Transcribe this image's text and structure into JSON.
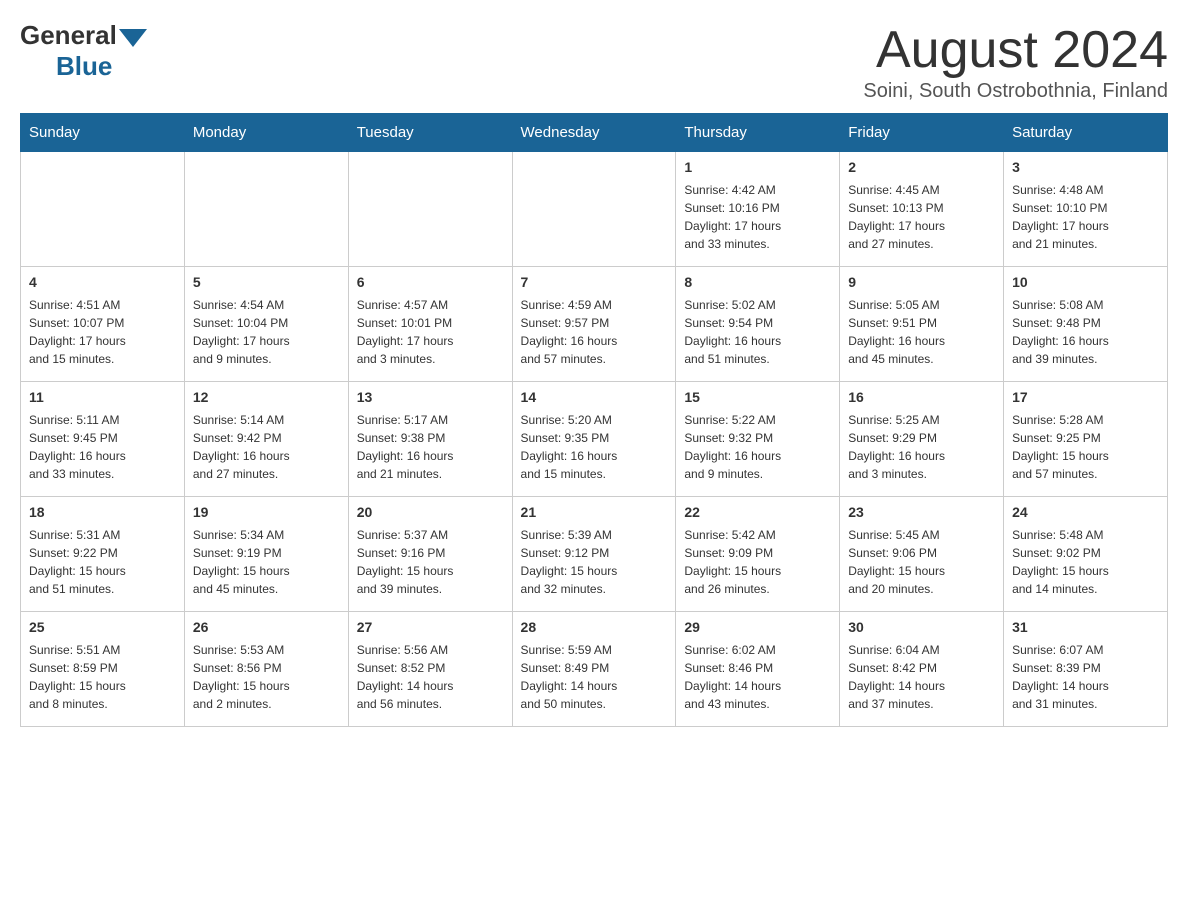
{
  "header": {
    "logo_general": "General",
    "logo_blue": "Blue",
    "month_title": "August 2024",
    "location": "Soini, South Ostrobothnia, Finland"
  },
  "weekdays": [
    "Sunday",
    "Monday",
    "Tuesday",
    "Wednesday",
    "Thursday",
    "Friday",
    "Saturday"
  ],
  "weeks": [
    [
      {
        "day": "",
        "info": ""
      },
      {
        "day": "",
        "info": ""
      },
      {
        "day": "",
        "info": ""
      },
      {
        "day": "",
        "info": ""
      },
      {
        "day": "1",
        "info": "Sunrise: 4:42 AM\nSunset: 10:16 PM\nDaylight: 17 hours\nand 33 minutes."
      },
      {
        "day": "2",
        "info": "Sunrise: 4:45 AM\nSunset: 10:13 PM\nDaylight: 17 hours\nand 27 minutes."
      },
      {
        "day": "3",
        "info": "Sunrise: 4:48 AM\nSunset: 10:10 PM\nDaylight: 17 hours\nand 21 minutes."
      }
    ],
    [
      {
        "day": "4",
        "info": "Sunrise: 4:51 AM\nSunset: 10:07 PM\nDaylight: 17 hours\nand 15 minutes."
      },
      {
        "day": "5",
        "info": "Sunrise: 4:54 AM\nSunset: 10:04 PM\nDaylight: 17 hours\nand 9 minutes."
      },
      {
        "day": "6",
        "info": "Sunrise: 4:57 AM\nSunset: 10:01 PM\nDaylight: 17 hours\nand 3 minutes."
      },
      {
        "day": "7",
        "info": "Sunrise: 4:59 AM\nSunset: 9:57 PM\nDaylight: 16 hours\nand 57 minutes."
      },
      {
        "day": "8",
        "info": "Sunrise: 5:02 AM\nSunset: 9:54 PM\nDaylight: 16 hours\nand 51 minutes."
      },
      {
        "day": "9",
        "info": "Sunrise: 5:05 AM\nSunset: 9:51 PM\nDaylight: 16 hours\nand 45 minutes."
      },
      {
        "day": "10",
        "info": "Sunrise: 5:08 AM\nSunset: 9:48 PM\nDaylight: 16 hours\nand 39 minutes."
      }
    ],
    [
      {
        "day": "11",
        "info": "Sunrise: 5:11 AM\nSunset: 9:45 PM\nDaylight: 16 hours\nand 33 minutes."
      },
      {
        "day": "12",
        "info": "Sunrise: 5:14 AM\nSunset: 9:42 PM\nDaylight: 16 hours\nand 27 minutes."
      },
      {
        "day": "13",
        "info": "Sunrise: 5:17 AM\nSunset: 9:38 PM\nDaylight: 16 hours\nand 21 minutes."
      },
      {
        "day": "14",
        "info": "Sunrise: 5:20 AM\nSunset: 9:35 PM\nDaylight: 16 hours\nand 15 minutes."
      },
      {
        "day": "15",
        "info": "Sunrise: 5:22 AM\nSunset: 9:32 PM\nDaylight: 16 hours\nand 9 minutes."
      },
      {
        "day": "16",
        "info": "Sunrise: 5:25 AM\nSunset: 9:29 PM\nDaylight: 16 hours\nand 3 minutes."
      },
      {
        "day": "17",
        "info": "Sunrise: 5:28 AM\nSunset: 9:25 PM\nDaylight: 15 hours\nand 57 minutes."
      }
    ],
    [
      {
        "day": "18",
        "info": "Sunrise: 5:31 AM\nSunset: 9:22 PM\nDaylight: 15 hours\nand 51 minutes."
      },
      {
        "day": "19",
        "info": "Sunrise: 5:34 AM\nSunset: 9:19 PM\nDaylight: 15 hours\nand 45 minutes."
      },
      {
        "day": "20",
        "info": "Sunrise: 5:37 AM\nSunset: 9:16 PM\nDaylight: 15 hours\nand 39 minutes."
      },
      {
        "day": "21",
        "info": "Sunrise: 5:39 AM\nSunset: 9:12 PM\nDaylight: 15 hours\nand 32 minutes."
      },
      {
        "day": "22",
        "info": "Sunrise: 5:42 AM\nSunset: 9:09 PM\nDaylight: 15 hours\nand 26 minutes."
      },
      {
        "day": "23",
        "info": "Sunrise: 5:45 AM\nSunset: 9:06 PM\nDaylight: 15 hours\nand 20 minutes."
      },
      {
        "day": "24",
        "info": "Sunrise: 5:48 AM\nSunset: 9:02 PM\nDaylight: 15 hours\nand 14 minutes."
      }
    ],
    [
      {
        "day": "25",
        "info": "Sunrise: 5:51 AM\nSunset: 8:59 PM\nDaylight: 15 hours\nand 8 minutes."
      },
      {
        "day": "26",
        "info": "Sunrise: 5:53 AM\nSunset: 8:56 PM\nDaylight: 15 hours\nand 2 minutes."
      },
      {
        "day": "27",
        "info": "Sunrise: 5:56 AM\nSunset: 8:52 PM\nDaylight: 14 hours\nand 56 minutes."
      },
      {
        "day": "28",
        "info": "Sunrise: 5:59 AM\nSunset: 8:49 PM\nDaylight: 14 hours\nand 50 minutes."
      },
      {
        "day": "29",
        "info": "Sunrise: 6:02 AM\nSunset: 8:46 PM\nDaylight: 14 hours\nand 43 minutes."
      },
      {
        "day": "30",
        "info": "Sunrise: 6:04 AM\nSunset: 8:42 PM\nDaylight: 14 hours\nand 37 minutes."
      },
      {
        "day": "31",
        "info": "Sunrise: 6:07 AM\nSunset: 8:39 PM\nDaylight: 14 hours\nand 31 minutes."
      }
    ]
  ]
}
